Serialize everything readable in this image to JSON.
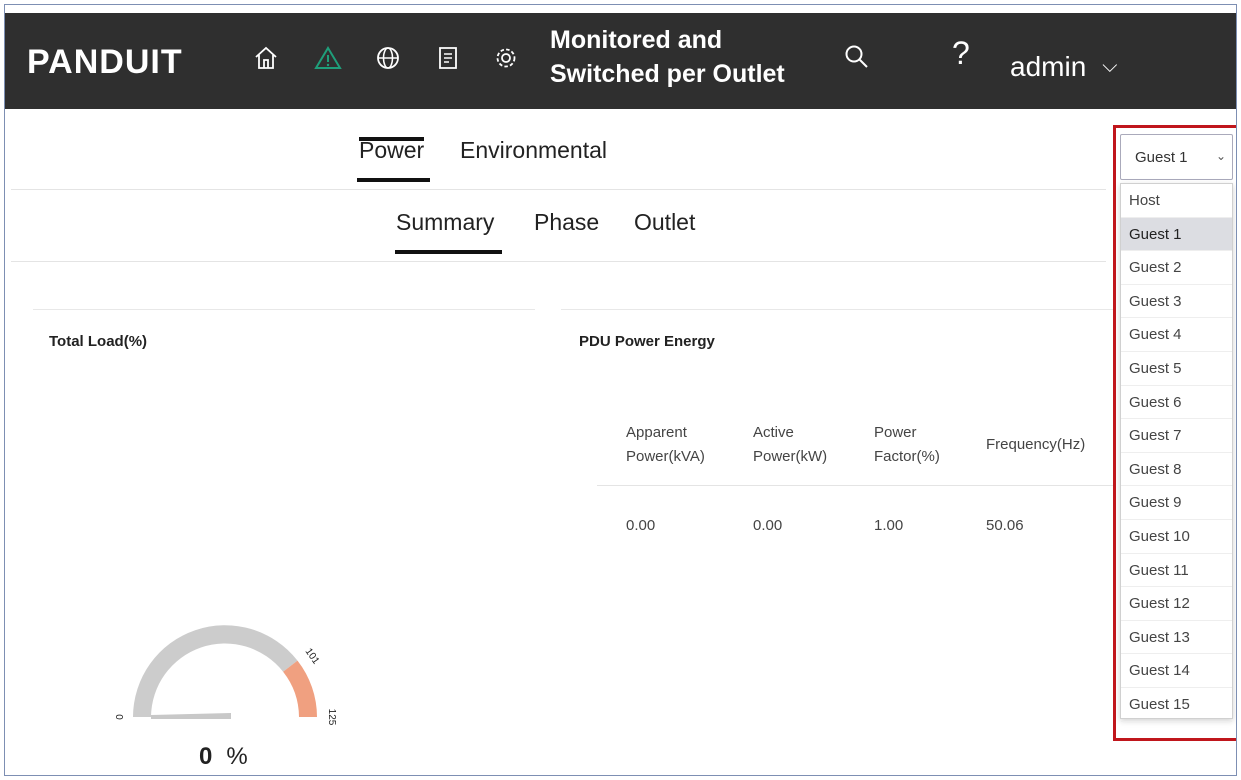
{
  "header": {
    "logo_text": "PANDUIT",
    "title_line1": "Monitored and",
    "title_line2": "Switched per Outlet",
    "help_label": "?",
    "user_label": "admin",
    "nav_icons": [
      "home-icon",
      "warning-icon",
      "globe-icon",
      "document-icon",
      "settings-icon"
    ],
    "warning_color": "#1f9e7a"
  },
  "tabs": {
    "primary": [
      "Power",
      "Environmental"
    ],
    "secondary": [
      "Summary",
      "Phase",
      "Outlet"
    ]
  },
  "total_load": {
    "title": "Total Load(%)",
    "value": "0",
    "unit": "%",
    "scale_min": "0",
    "scale_warn": "101",
    "scale_max": "125",
    "track_color": "#cccccc",
    "warn_color": "#f0a080"
  },
  "energy": {
    "title": "PDU Power Energy",
    "headers": [
      [
        "Apparent",
        "Power(kVA)"
      ],
      [
        "Active",
        "Power(kW)"
      ],
      [
        "Power",
        "Factor(%)"
      ],
      [
        "Frequency(Hz)",
        ""
      ]
    ],
    "values": [
      "0.00",
      "0.00",
      "1.00",
      "50.06"
    ]
  },
  "guest_select": {
    "selected": "Guest 1",
    "options": [
      "Host",
      "Guest 1",
      "Guest 2",
      "Guest 3",
      "Guest 4",
      "Guest 5",
      "Guest 6",
      "Guest 7",
      "Guest 8",
      "Guest 9",
      "Guest 10",
      "Guest 11",
      "Guest 12",
      "Guest 13",
      "Guest 14",
      "Guest 15"
    ],
    "highlight_color": "#c0161c"
  }
}
